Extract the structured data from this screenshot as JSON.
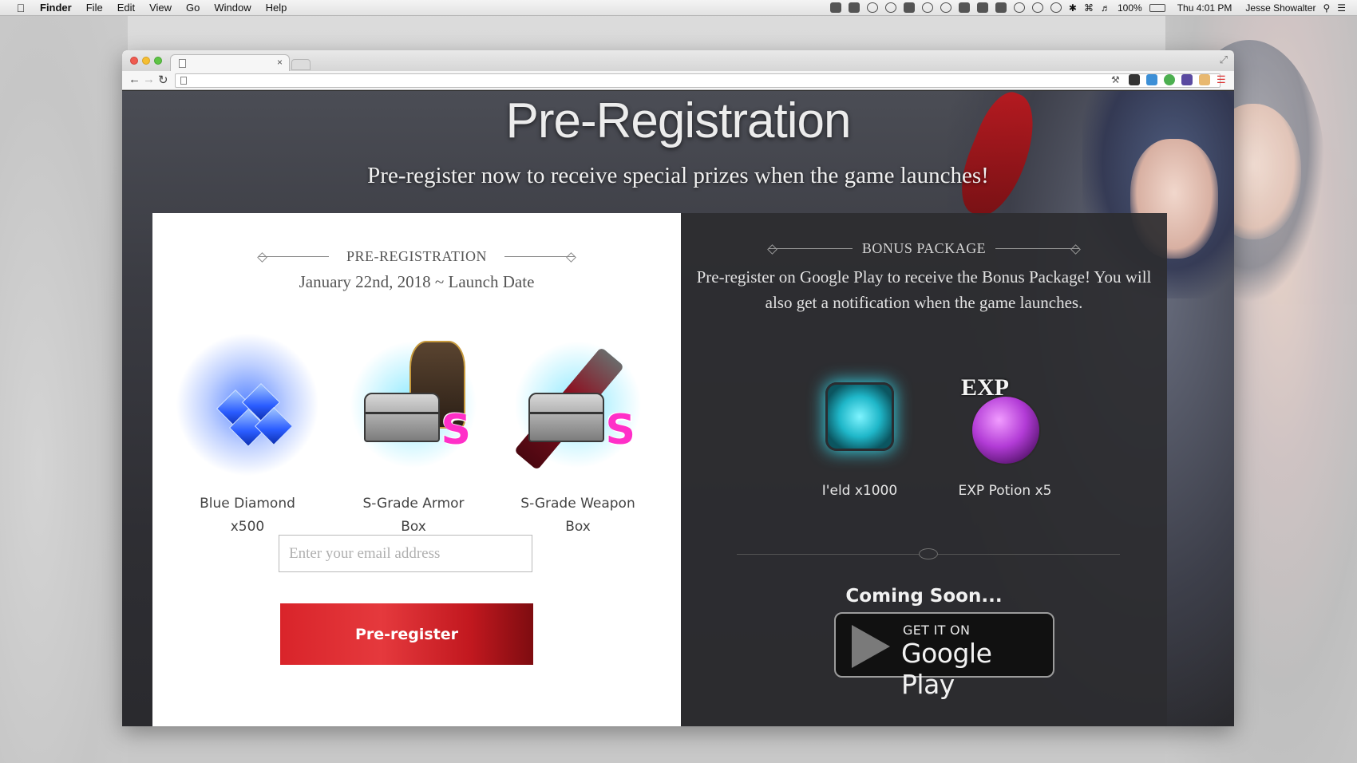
{
  "menubar": {
    "app_name": "Finder",
    "items": [
      "File",
      "Edit",
      "View",
      "Go",
      "Window",
      "Help"
    ],
    "battery": "100%",
    "clock": "Thu 4:01 PM",
    "user": "Jesse Showalter"
  },
  "browser": {
    "tab_close": "×",
    "url": ""
  },
  "hero": {
    "title": "Pre-Registration",
    "subtitle": "Pre-register now to receive special prizes when the game launches!"
  },
  "registration": {
    "heading": "PRE-REGISTRATION",
    "date": "January 22nd, 2018 ~ Launch Date",
    "rewards": [
      {
        "label_line1": "Blue Diamond",
        "label_line2": "x500",
        "icon": "blue-diamond-icon"
      },
      {
        "label_line1": "S-Grade Armor",
        "label_line2": "Box",
        "icon": "armor-box-icon"
      },
      {
        "label_line1": "S-Grade Weapon",
        "label_line2": "Box",
        "icon": "weapon-box-icon"
      }
    ],
    "grade_badge": "S",
    "email_placeholder": "Enter your email address",
    "button_label": "Pre-register",
    "button_color": "#d9242a"
  },
  "bonus": {
    "heading": "BONUS PACKAGE",
    "description": "Pre-register on Google Play to receive the Bonus Package! You will also get a notification when the game launches.",
    "items": [
      {
        "label": "I'eld x1000",
        "icon": "ield-cube-icon"
      },
      {
        "label": "EXP Potion x5",
        "icon": "exp-potion-icon"
      }
    ],
    "exp_text": "EXP",
    "coming_soon": "Coming Soon...",
    "badge_line1": "GET IT ON",
    "badge_line2": "Google Play"
  }
}
